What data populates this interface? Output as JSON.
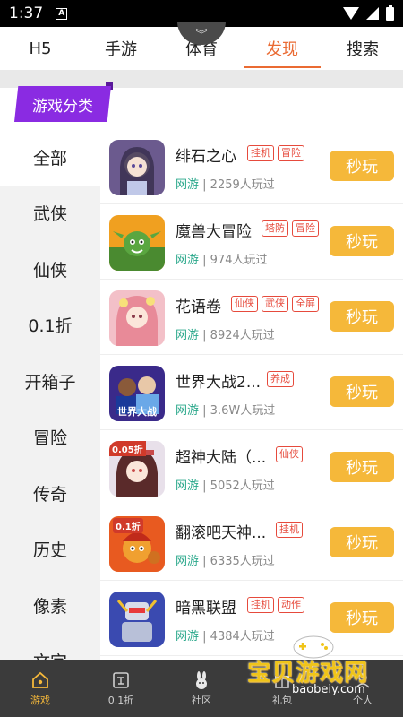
{
  "status": {
    "time": "1:37"
  },
  "tabs": [
    {
      "label": "H5",
      "active": false
    },
    {
      "label": "手游",
      "active": false
    },
    {
      "label": "体育",
      "active": false
    },
    {
      "label": "发现",
      "active": true
    },
    {
      "label": "搜索",
      "active": false
    }
  ],
  "category_badge": "游戏分类",
  "sidebar": [
    {
      "label": "全部",
      "active": true
    },
    {
      "label": "武侠",
      "active": false
    },
    {
      "label": "仙侠",
      "active": false
    },
    {
      "label": "0.1折",
      "active": false
    },
    {
      "label": "开箱子",
      "active": false
    },
    {
      "label": "冒险",
      "active": false
    },
    {
      "label": "传奇",
      "active": false
    },
    {
      "label": "历史",
      "active": false
    },
    {
      "label": "像素",
      "active": false
    },
    {
      "label": "文字",
      "active": false
    }
  ],
  "games": [
    {
      "name": "绯石之心",
      "tags": [
        "挂机",
        "冒险"
      ],
      "category": "网游",
      "players": "2259人玩过",
      "play_label": "秒玩",
      "icon": "anime-girl-icon",
      "icon_color": "#6b5a8e"
    },
    {
      "name": "魔兽大冒险",
      "tags": [
        "塔防",
        "冒险"
      ],
      "category": "网游",
      "players": "974人玩过",
      "play_label": "秒玩",
      "icon": "goblin-icon",
      "icon_color": "#5aa640"
    },
    {
      "name": "花语卷",
      "tags": [
        "仙侠",
        "武侠",
        "全屏"
      ],
      "category": "网游",
      "players": "8924人玩过",
      "play_label": "秒玩",
      "icon": "flower-girl-icon",
      "icon_color": "#e89aa8"
    },
    {
      "name": "世界大战2...",
      "tags": [
        "养成"
      ],
      "category": "网游",
      "players": "3.6W人玩过",
      "play_label": "秒玩",
      "icon": "soccer-icon",
      "icon_color": "#3a2a8a",
      "icon_text": "世界大战"
    },
    {
      "name": "超神大陆（...",
      "tags": [
        "仙侠"
      ],
      "category": "网游",
      "players": "5052人玩过",
      "play_label": "秒玩",
      "icon": "anime-girl-icon",
      "icon_color": "#c84a4a",
      "icon_text": "0.05折"
    },
    {
      "name": "翻滚吧天神...",
      "tags": [
        "挂机"
      ],
      "category": "网游",
      "players": "6335人玩过",
      "play_label": "秒玩",
      "icon": "cartoon-hero-icon",
      "icon_color": "#e85a20",
      "icon_text": "0.1折"
    },
    {
      "name": "暗黑联盟",
      "tags": [
        "挂机",
        "动作"
      ],
      "category": "网游",
      "players": "4384人玩过",
      "play_label": "秒玩",
      "icon": "robot-icon",
      "icon_color": "#3a4ab0"
    }
  ],
  "bottom_nav": [
    {
      "label": "游戏",
      "icon": "home-icon",
      "active": true
    },
    {
      "label": "0.1折",
      "icon": "discount-icon",
      "active": false
    },
    {
      "label": "社区",
      "icon": "rabbit-icon",
      "active": false
    },
    {
      "label": "礼包",
      "icon": "gift-icon",
      "active": false
    },
    {
      "label": "个人",
      "icon": "user-icon",
      "active": false
    }
  ],
  "watermark": {
    "text": "宝贝游戏网",
    "url": "baobeiy.com"
  },
  "colors": {
    "accent": "#ea6b33",
    "play_button": "#f5b83a",
    "badge": "#8a2be2",
    "tag": "#e64a3c",
    "category": "#2aa88b"
  }
}
